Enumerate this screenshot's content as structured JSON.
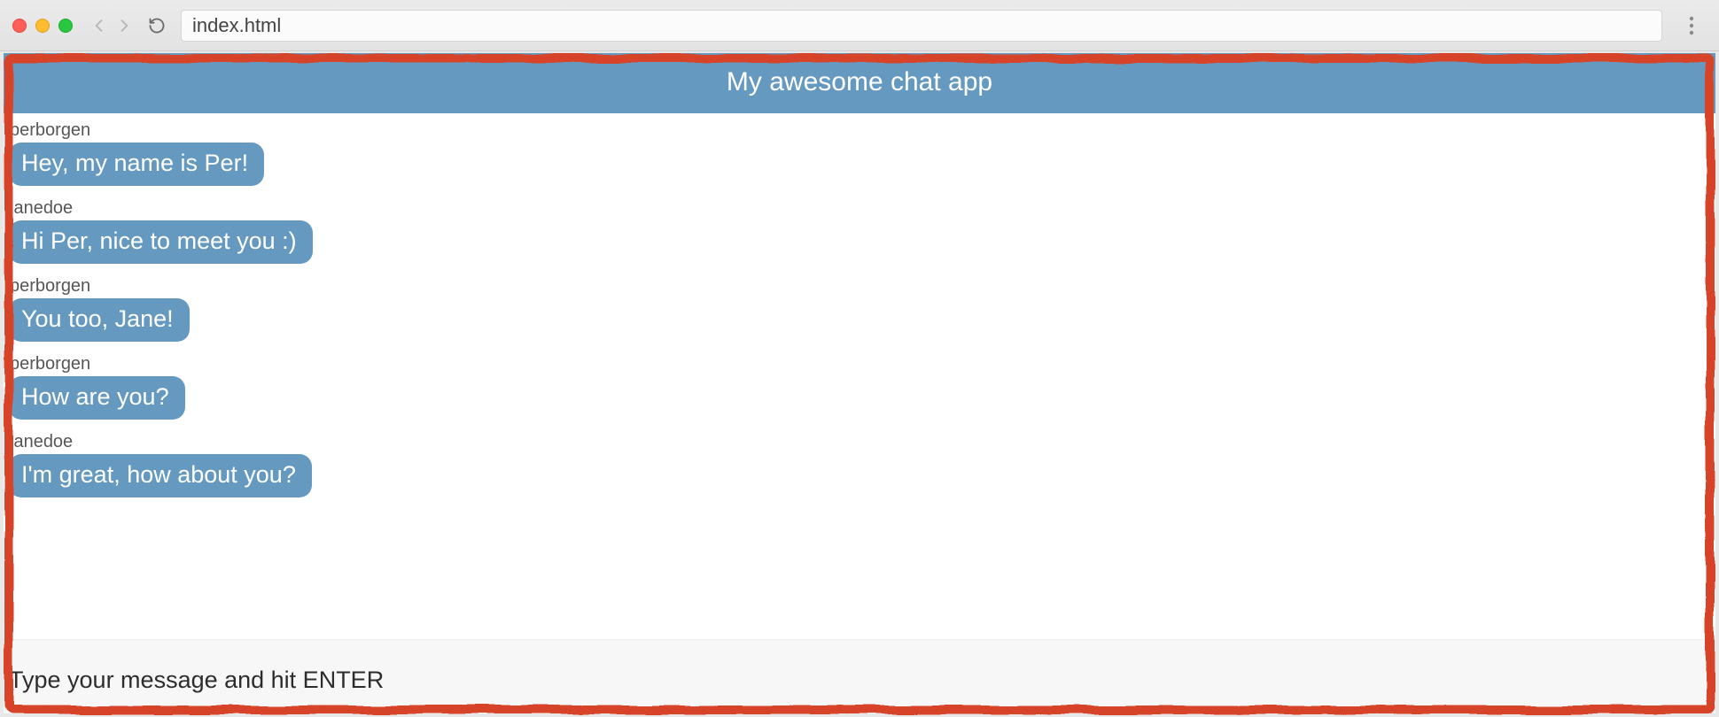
{
  "browser": {
    "address": "index.html"
  },
  "app": {
    "title": "My awesome chat app",
    "messages": [
      {
        "user": "perborgen",
        "text": "Hey, my name is Per!"
      },
      {
        "user": "janedoe",
        "text": "Hi Per, nice to meet you :)"
      },
      {
        "user": "perborgen",
        "text": "You too, Jane!"
      },
      {
        "user": "perborgen",
        "text": "How are you?"
      },
      {
        "user": "janedoe",
        "text": "I'm great, how about you?"
      }
    ],
    "input_placeholder": "Type your message and hit ENTER"
  },
  "colors": {
    "accent": "#6599c0",
    "border_sketch": "#d6452b"
  }
}
